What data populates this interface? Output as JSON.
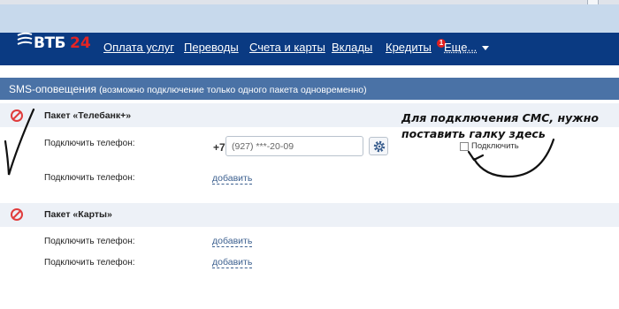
{
  "logo": {
    "brand": "ВТБ",
    "number": "24"
  },
  "nav": {
    "items": [
      "Оплата услуг",
      "Переводы",
      "Счета и карты",
      "Вклады",
      "Кредиты"
    ],
    "more_label": "Еще...",
    "badge_count": "1"
  },
  "section": {
    "title": "SMS-оповещения",
    "note": "(возможно подключение только одного пакета одновременно)"
  },
  "packages": [
    {
      "name": "Пакет «Телебанк+»",
      "phone_label": "Подключить телефон:",
      "phone_prefix": "+7",
      "phone_value": "(927) ***-20-09",
      "second_label": "Подключить телефон:",
      "add_label": "добавить",
      "checkbox_label": "Подключить",
      "checkbox_checked": false
    },
    {
      "name": "Пакет «Карты»",
      "rows": [
        {
          "label": "Подключить телефон:",
          "add_label": "добавить"
        },
        {
          "label": "Подключить телефон:",
          "add_label": "добавить"
        }
      ]
    }
  ],
  "annotation": {
    "line1": "Для подключения СМС, нужно",
    "line2": "поставить галку здесь"
  },
  "colors": {
    "nav_bg": "#0a3a82",
    "section_bar": "#4a72a6",
    "package_row": "#edf1f7",
    "disabled_icon": "#e03c3c",
    "logo_accent": "#e22424"
  },
  "icons": [
    "vtb-logo-swoosh-icon",
    "disabled-circle-icon",
    "gear-icon",
    "chevron-down-icon"
  ]
}
